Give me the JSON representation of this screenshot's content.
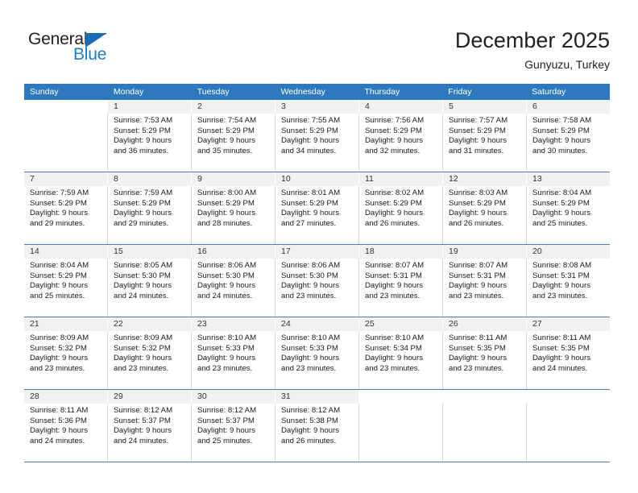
{
  "brand": {
    "name_top": "General",
    "name_bottom": "Blue",
    "triangle_icon": "triangle-icon",
    "color_dark": "#231f20",
    "color_blue": "#1b7cc4"
  },
  "header": {
    "title": "December 2025",
    "subtitle": "Gunyuzu, Turkey"
  },
  "theme": {
    "header_bg": "#2e79bd",
    "day_number_bg": "#f1f1f1",
    "week_divider": "#3f7fbe",
    "cell_divider": "#d9d9d9",
    "text": "#1a1a1a"
  },
  "weekdays": [
    "Sunday",
    "Monday",
    "Tuesday",
    "Wednesday",
    "Thursday",
    "Friday",
    "Saturday"
  ],
  "weeks": [
    {
      "days": [
        {
          "num": "",
          "sunrise": "",
          "sunset": "",
          "daylight1": "",
          "daylight2": ""
        },
        {
          "num": "1",
          "sunrise": "Sunrise: 7:53 AM",
          "sunset": "Sunset: 5:29 PM",
          "daylight1": "Daylight: 9 hours",
          "daylight2": "and 36 minutes."
        },
        {
          "num": "2",
          "sunrise": "Sunrise: 7:54 AM",
          "sunset": "Sunset: 5:29 PM",
          "daylight1": "Daylight: 9 hours",
          "daylight2": "and 35 minutes."
        },
        {
          "num": "3",
          "sunrise": "Sunrise: 7:55 AM",
          "sunset": "Sunset: 5:29 PM",
          "daylight1": "Daylight: 9 hours",
          "daylight2": "and 34 minutes."
        },
        {
          "num": "4",
          "sunrise": "Sunrise: 7:56 AM",
          "sunset": "Sunset: 5:29 PM",
          "daylight1": "Daylight: 9 hours",
          "daylight2": "and 32 minutes."
        },
        {
          "num": "5",
          "sunrise": "Sunrise: 7:57 AM",
          "sunset": "Sunset: 5:29 PM",
          "daylight1": "Daylight: 9 hours",
          "daylight2": "and 31 minutes."
        },
        {
          "num": "6",
          "sunrise": "Sunrise: 7:58 AM",
          "sunset": "Sunset: 5:29 PM",
          "daylight1": "Daylight: 9 hours",
          "daylight2": "and 30 minutes."
        }
      ]
    },
    {
      "days": [
        {
          "num": "7",
          "sunrise": "Sunrise: 7:59 AM",
          "sunset": "Sunset: 5:29 PM",
          "daylight1": "Daylight: 9 hours",
          "daylight2": "and 29 minutes."
        },
        {
          "num": "8",
          "sunrise": "Sunrise: 7:59 AM",
          "sunset": "Sunset: 5:29 PM",
          "daylight1": "Daylight: 9 hours",
          "daylight2": "and 29 minutes."
        },
        {
          "num": "9",
          "sunrise": "Sunrise: 8:00 AM",
          "sunset": "Sunset: 5:29 PM",
          "daylight1": "Daylight: 9 hours",
          "daylight2": "and 28 minutes."
        },
        {
          "num": "10",
          "sunrise": "Sunrise: 8:01 AM",
          "sunset": "Sunset: 5:29 PM",
          "daylight1": "Daylight: 9 hours",
          "daylight2": "and 27 minutes."
        },
        {
          "num": "11",
          "sunrise": "Sunrise: 8:02 AM",
          "sunset": "Sunset: 5:29 PM",
          "daylight1": "Daylight: 9 hours",
          "daylight2": "and 26 minutes."
        },
        {
          "num": "12",
          "sunrise": "Sunrise: 8:03 AM",
          "sunset": "Sunset: 5:29 PM",
          "daylight1": "Daylight: 9 hours",
          "daylight2": "and 26 minutes."
        },
        {
          "num": "13",
          "sunrise": "Sunrise: 8:04 AM",
          "sunset": "Sunset: 5:29 PM",
          "daylight1": "Daylight: 9 hours",
          "daylight2": "and 25 minutes."
        }
      ]
    },
    {
      "days": [
        {
          "num": "14",
          "sunrise": "Sunrise: 8:04 AM",
          "sunset": "Sunset: 5:29 PM",
          "daylight1": "Daylight: 9 hours",
          "daylight2": "and 25 minutes."
        },
        {
          "num": "15",
          "sunrise": "Sunrise: 8:05 AM",
          "sunset": "Sunset: 5:30 PM",
          "daylight1": "Daylight: 9 hours",
          "daylight2": "and 24 minutes."
        },
        {
          "num": "16",
          "sunrise": "Sunrise: 8:06 AM",
          "sunset": "Sunset: 5:30 PM",
          "daylight1": "Daylight: 9 hours",
          "daylight2": "and 24 minutes."
        },
        {
          "num": "17",
          "sunrise": "Sunrise: 8:06 AM",
          "sunset": "Sunset: 5:30 PM",
          "daylight1": "Daylight: 9 hours",
          "daylight2": "and 23 minutes."
        },
        {
          "num": "18",
          "sunrise": "Sunrise: 8:07 AM",
          "sunset": "Sunset: 5:31 PM",
          "daylight1": "Daylight: 9 hours",
          "daylight2": "and 23 minutes."
        },
        {
          "num": "19",
          "sunrise": "Sunrise: 8:07 AM",
          "sunset": "Sunset: 5:31 PM",
          "daylight1": "Daylight: 9 hours",
          "daylight2": "and 23 minutes."
        },
        {
          "num": "20",
          "sunrise": "Sunrise: 8:08 AM",
          "sunset": "Sunset: 5:31 PM",
          "daylight1": "Daylight: 9 hours",
          "daylight2": "and 23 minutes."
        }
      ]
    },
    {
      "days": [
        {
          "num": "21",
          "sunrise": "Sunrise: 8:09 AM",
          "sunset": "Sunset: 5:32 PM",
          "daylight1": "Daylight: 9 hours",
          "daylight2": "and 23 minutes."
        },
        {
          "num": "22",
          "sunrise": "Sunrise: 8:09 AM",
          "sunset": "Sunset: 5:32 PM",
          "daylight1": "Daylight: 9 hours",
          "daylight2": "and 23 minutes."
        },
        {
          "num": "23",
          "sunrise": "Sunrise: 8:10 AM",
          "sunset": "Sunset: 5:33 PM",
          "daylight1": "Daylight: 9 hours",
          "daylight2": "and 23 minutes."
        },
        {
          "num": "24",
          "sunrise": "Sunrise: 8:10 AM",
          "sunset": "Sunset: 5:33 PM",
          "daylight1": "Daylight: 9 hours",
          "daylight2": "and 23 minutes."
        },
        {
          "num": "25",
          "sunrise": "Sunrise: 8:10 AM",
          "sunset": "Sunset: 5:34 PM",
          "daylight1": "Daylight: 9 hours",
          "daylight2": "and 23 minutes."
        },
        {
          "num": "26",
          "sunrise": "Sunrise: 8:11 AM",
          "sunset": "Sunset: 5:35 PM",
          "daylight1": "Daylight: 9 hours",
          "daylight2": "and 23 minutes."
        },
        {
          "num": "27",
          "sunrise": "Sunrise: 8:11 AM",
          "sunset": "Sunset: 5:35 PM",
          "daylight1": "Daylight: 9 hours",
          "daylight2": "and 24 minutes."
        }
      ]
    },
    {
      "days": [
        {
          "num": "28",
          "sunrise": "Sunrise: 8:11 AM",
          "sunset": "Sunset: 5:36 PM",
          "daylight1": "Daylight: 9 hours",
          "daylight2": "and 24 minutes."
        },
        {
          "num": "29",
          "sunrise": "Sunrise: 8:12 AM",
          "sunset": "Sunset: 5:37 PM",
          "daylight1": "Daylight: 9 hours",
          "daylight2": "and 24 minutes."
        },
        {
          "num": "30",
          "sunrise": "Sunrise: 8:12 AM",
          "sunset": "Sunset: 5:37 PM",
          "daylight1": "Daylight: 9 hours",
          "daylight2": "and 25 minutes."
        },
        {
          "num": "31",
          "sunrise": "Sunrise: 8:12 AM",
          "sunset": "Sunset: 5:38 PM",
          "daylight1": "Daylight: 9 hours",
          "daylight2": "and 26 minutes."
        },
        {
          "num": "",
          "sunrise": "",
          "sunset": "",
          "daylight1": "",
          "daylight2": ""
        },
        {
          "num": "",
          "sunrise": "",
          "sunset": "",
          "daylight1": "",
          "daylight2": ""
        },
        {
          "num": "",
          "sunrise": "",
          "sunset": "",
          "daylight1": "",
          "daylight2": ""
        }
      ]
    }
  ]
}
